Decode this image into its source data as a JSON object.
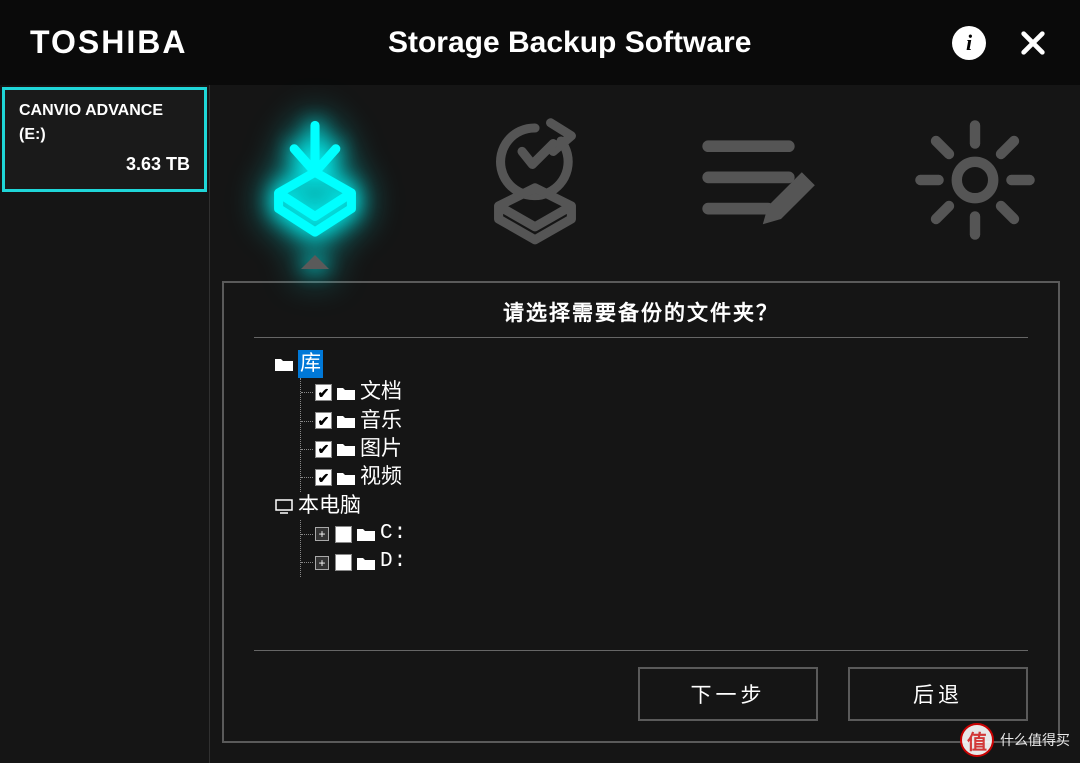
{
  "header": {
    "brand": "TOSHIBA",
    "title": "Storage Backup Software",
    "info_symbol": "i",
    "close_symbol": "✕"
  },
  "sidebar": {
    "drive": {
      "name": "CANVIO ADVANCE",
      "letter": "(E:)",
      "size": "3.63 TB"
    }
  },
  "tabs": {
    "active_index": 0,
    "items": [
      "backup",
      "restore",
      "edit-plan",
      "settings"
    ]
  },
  "panel": {
    "title": "请选择需要备份的文件夹？",
    "tree": {
      "library": {
        "label": "库",
        "children": [
          {
            "label": "文档",
            "checked": true
          },
          {
            "label": "音乐",
            "checked": true
          },
          {
            "label": "图片",
            "checked": true
          },
          {
            "label": "视频",
            "checked": true
          }
        ]
      },
      "computer": {
        "label": "本电脑",
        "children": [
          {
            "label": "C:",
            "checked": false,
            "expandable": true
          },
          {
            "label": "D:",
            "checked": false,
            "expandable": true
          }
        ]
      }
    },
    "buttons": {
      "next": "下一步",
      "back": "后退"
    }
  },
  "watermark": {
    "badge": "值",
    "text": "什么值得买"
  },
  "colors": {
    "accent": "#1fd6d8",
    "glow": "#00ffff",
    "border": "#5a5a5a"
  }
}
